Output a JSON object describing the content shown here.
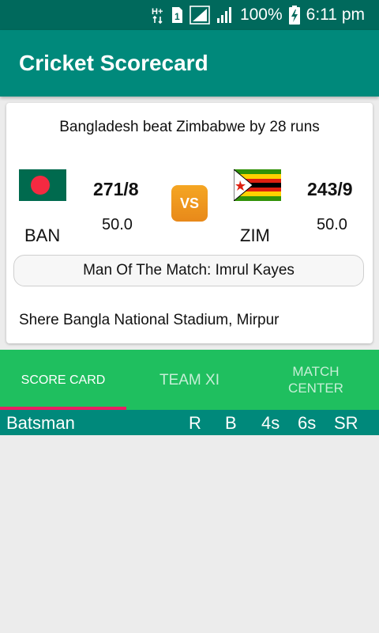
{
  "status_bar": {
    "network_type": "H+",
    "sim_slot": "1",
    "battery": "100%",
    "time": "6:11 pm",
    "icons": [
      "data-arrows-icon",
      "sim-icon",
      "signal-icon",
      "signal-icon",
      "battery-charging-icon"
    ]
  },
  "app_bar": {
    "title": "Cricket Scorecard"
  },
  "match": {
    "result": "Bangladesh beat Zimbabwe by 28 runs",
    "vs_label": "VS",
    "team1": {
      "name": "BAN",
      "score": "271/8",
      "overs": "50.0",
      "flag": "bangladesh-flag-icon"
    },
    "team2": {
      "name": "ZIM",
      "score": "243/9",
      "overs": "50.0",
      "flag": "zimbabwe-flag-icon"
    },
    "man_of_the_match": "Man Of The Match: Imrul Kayes",
    "venue": "Shere Bangla National Stadium, Mirpur"
  },
  "tabs": [
    {
      "label": "SCORE CARD",
      "active": true
    },
    {
      "label": "TEAM XI",
      "active": false
    },
    {
      "label": "MATCH\nCENTER",
      "active": false
    }
  ],
  "table": {
    "columns": [
      "Batsman",
      "R",
      "B",
      "4s",
      "6s",
      "SR"
    ]
  },
  "colors": {
    "status_bar": "#00695c",
    "app_bar": "#00897b",
    "tab_bar": "#1fbf5f",
    "tab_indicator": "#e91e63",
    "vs_badge": "#f5a623",
    "background": "#ececec"
  }
}
